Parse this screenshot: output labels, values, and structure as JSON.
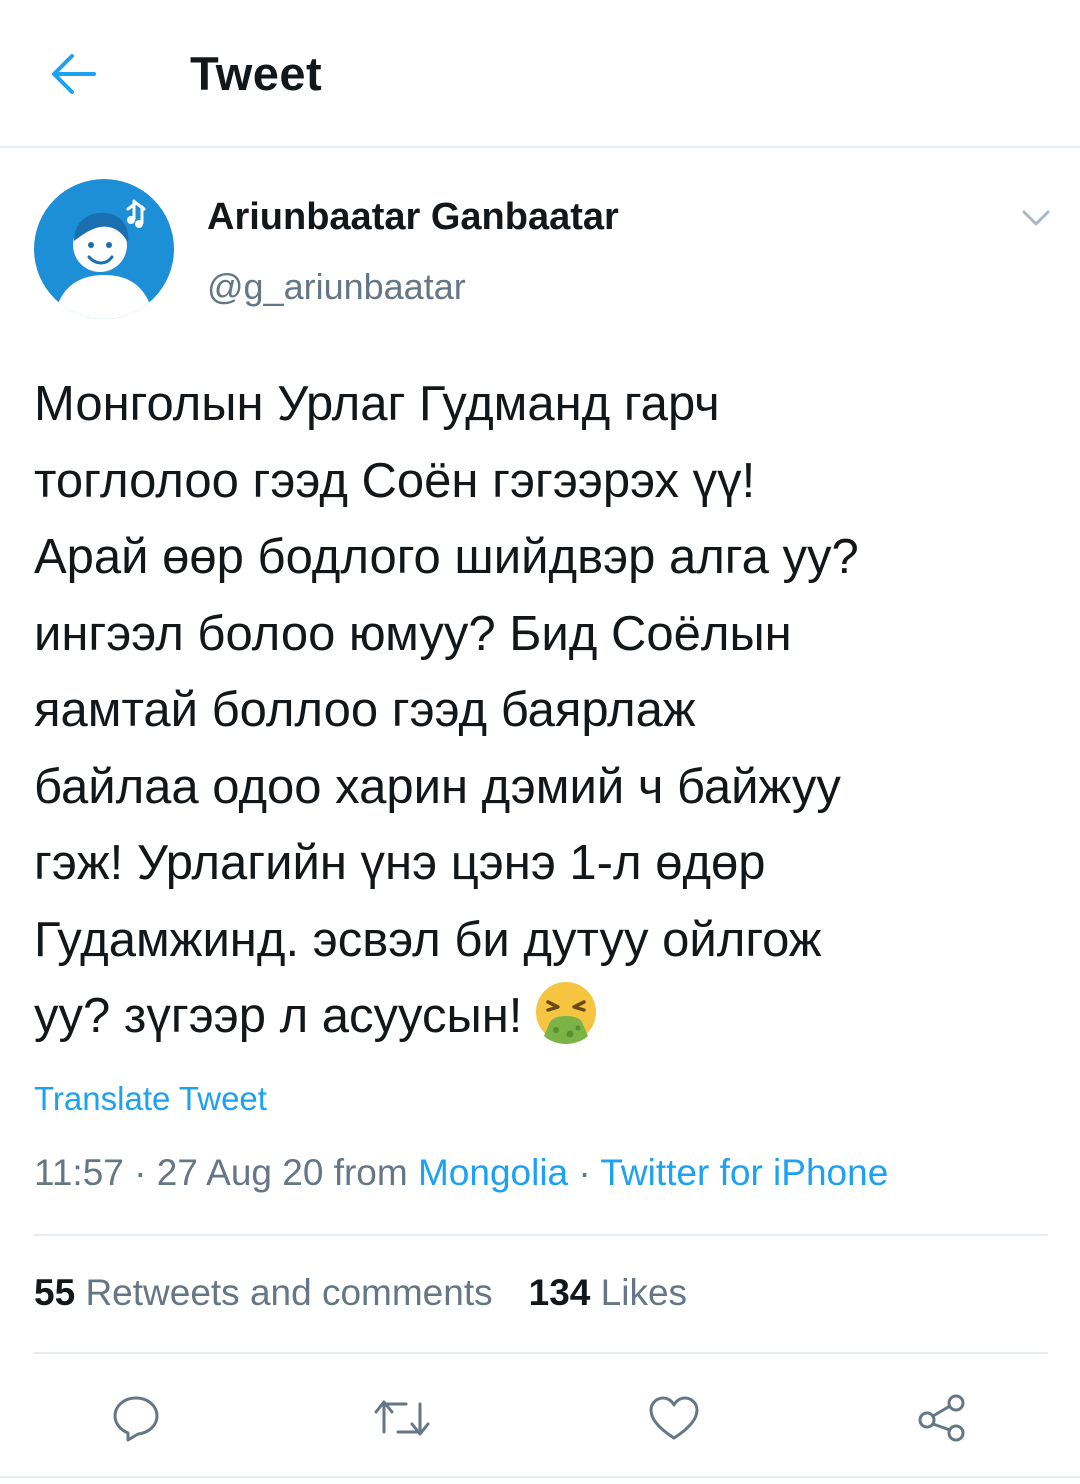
{
  "header": {
    "title": "Tweet",
    "back_icon": "arrow-left-icon"
  },
  "author": {
    "display_name": "Ariunbaatar Ganbaatar",
    "handle": "@g_ariunbaatar",
    "avatar_bg": "#1d8fd6"
  },
  "tweet": {
    "text": "Монголын Урлаг Гудманд гарч\nтоглолоо гээд Соён гэгээрэх үү!\nАрай өөр бодлого шийдвэр алга уу?\nингээл болоо юмуу? Бид Соёлын\nяамтай боллоо гээд баярлаж\nбайлаа одоо харин дэмий ч байжуу\nгэж! Урлагийн үнэ цэнэ 1-л өдөр\nГудамжинд. эсвэл би дутуу ойлгож\nуу? зүгээр л асуусын!",
    "emoji": "vomiting-face-emoji",
    "translate_label": "Translate Tweet"
  },
  "meta": {
    "time": "11:57",
    "sep1": " · ",
    "date": "27 Aug 20",
    "from_word": " from ",
    "location": "Mongolia",
    "sep2": " · ",
    "source": "Twitter for iPhone"
  },
  "stats": {
    "retweets_count": "55",
    "retweets_label": "Retweets and comments",
    "likes_count": "134",
    "likes_label": "Likes"
  },
  "actions": {
    "reply_icon": "reply-icon",
    "retweet_icon": "retweet-icon",
    "like_icon": "heart-icon",
    "share_icon": "share-icon"
  },
  "colors": {
    "accent": "#1da1f2",
    "secondary_text": "#657786",
    "divider": "#e6ecf0"
  }
}
